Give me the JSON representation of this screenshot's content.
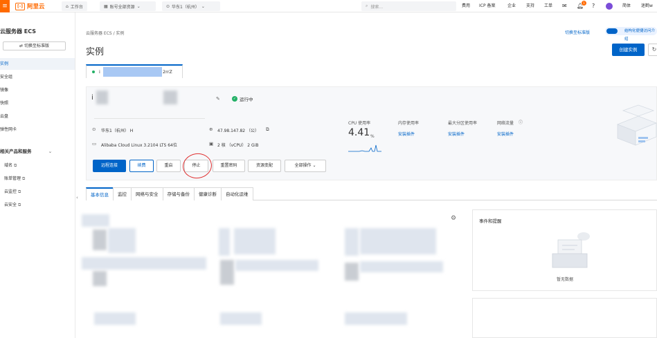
{
  "topbar": {
    "menu_glyph": "≡",
    "logo_mark": "[-]",
    "logo_text": "阿里云",
    "workbench": "工作台",
    "account": "账号全部资源",
    "region": "华东1（杭州）",
    "search_placeholder": "搜索...",
    "nav": [
      "费用",
      "ICP 备案",
      "企业",
      "支持",
      "工单"
    ],
    "notification_count": "1",
    "lang": "简体",
    "user": "迷鹤w"
  },
  "sidebar": {
    "title": "云服务器 ECS",
    "switch_label": "⇄ 切换至标准版",
    "items": [
      "实例",
      "安全组",
      "镜像",
      "快照",
      "云盘",
      "弹性网卡"
    ],
    "section_title": "相关产品和服务",
    "links": [
      "域名",
      "账单管理",
      "云监控",
      "云安全"
    ],
    "collapse_glyph": "‹"
  },
  "header": {
    "breadcrumb": "云服务器 ECS  /  实例",
    "title": "实例",
    "switch_std": "切换至标准版",
    "toggle_label": "结构化便捷访问介绍",
    "create_button": "创建实例",
    "refresh_glyph": "↻"
  },
  "instance_tab": {
    "prefix": "i",
    "suffix": "2rrZ"
  },
  "instance": {
    "name_prefix": "i",
    "status": "运行中",
    "region": "华东1（杭州）  H",
    "ip": "47.98.147.82   （公）",
    "os": "Alibaba Cloud Linux 3.2104 LTS 64位",
    "spec": "2 核  （vCPU）   2 GiB"
  },
  "metrics": {
    "cpu_label": "CPU 使用率",
    "cpu_value": "4.41",
    "cpu_unit": "%",
    "mem_label": "内存使用率",
    "disk_label": "最大分区使用率",
    "net_label": "网络流量",
    "install_link": "安装插件"
  },
  "actions": [
    "远程连接",
    "续费",
    "重启",
    "停止",
    "重置密码",
    "资源变配",
    "全部操作 ⌄"
  ],
  "tabs": [
    "基本信息",
    "监控",
    "网络与安全",
    "存储与备份",
    "健康诊断",
    "自动化运维"
  ],
  "events": {
    "title": "事件和提醒",
    "empty": "暂无数据"
  },
  "colors": {
    "brand": "#ff6a00",
    "primary": "#0064c8",
    "running": "#23b066",
    "annotation": "#e03030"
  }
}
